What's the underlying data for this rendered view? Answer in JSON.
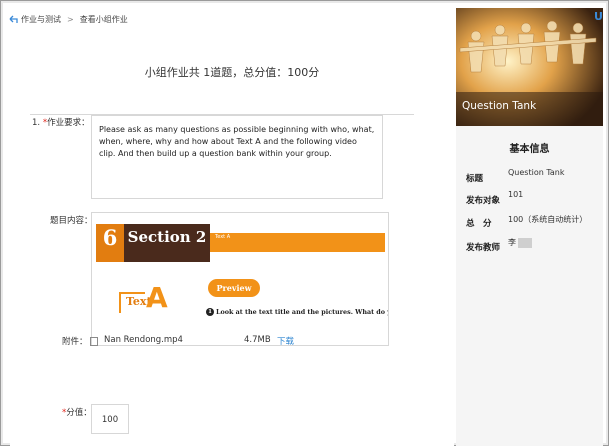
{
  "breadcrumb": {
    "items": [
      "作业与测试",
      "查看小组作业"
    ],
    "separator": ">"
  },
  "summary": "小组作业共 1道题，总分值：100分",
  "question": {
    "number": "1.",
    "req_label": "作业要求：",
    "req_text": "Please ask as many questions as possible beginning with who, what, when, where, why and how about Text A and the following video clip. And then build up a question bank within your group.",
    "content_label": "题目内容：",
    "content_image": {
      "section_num": "6",
      "section_title": "Section 2",
      "text_a_small": "Text A",
      "preview_task": "Preview task",
      "text_word": "Text",
      "text_letter": "A",
      "instruction_num": "1",
      "instruction": "Look at the text title and the pictures. What do you think the"
    },
    "attach_label": "附件：",
    "file_name": "Nan Rendong.mp4",
    "file_size": "4.7MB",
    "download": "下载",
    "score_label": "分值：",
    "score_value": "100"
  },
  "sidebar": {
    "banner_title": "Question Tank",
    "u_mark": "U",
    "info_title": "基本信息",
    "fields": [
      {
        "key": "标题",
        "value": "Question Tank"
      },
      {
        "key": "发布对象",
        "value": "101"
      },
      {
        "key": "总　分",
        "value": "100（系统自动统计）"
      },
      {
        "key": "发布教师",
        "value": "李"
      }
    ]
  },
  "colors": {
    "accent_orange": "#f29218",
    "section_brown": "#4a2a1c",
    "link_blue": "#2f86d1",
    "required_red": "#e0261c"
  },
  "icons": [
    "back-arrow-icon",
    "file-icon"
  ]
}
